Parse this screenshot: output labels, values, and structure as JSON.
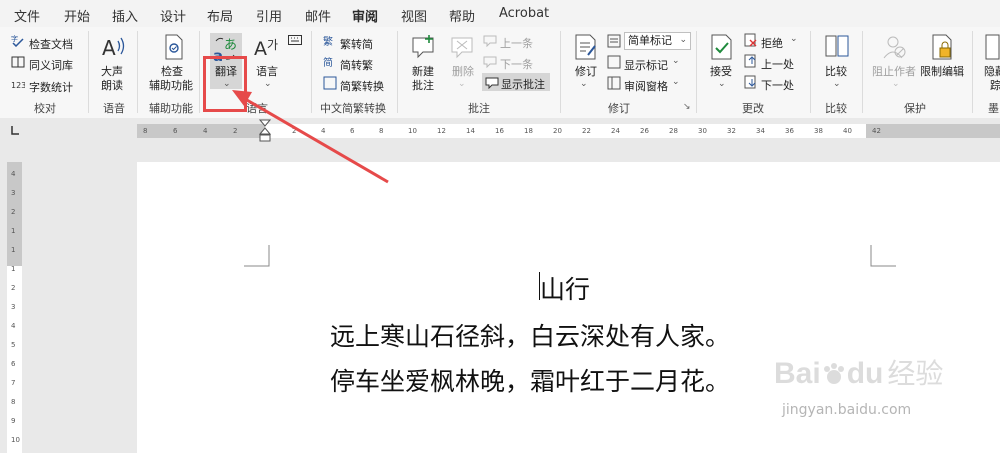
{
  "tabs": [
    "文件",
    "开始",
    "插入",
    "设计",
    "布局",
    "引用",
    "邮件",
    "审阅",
    "视图",
    "帮助",
    "Acrobat"
  ],
  "active_tab": "审阅",
  "ribbon": {
    "proofing": {
      "spelling": "检查文档",
      "thesaurus": "同义词库",
      "wordcount": "字数统计",
      "label": "校对"
    },
    "speech": {
      "read_aloud_1": "大声",
      "read_aloud_2": "朗读",
      "label": "语音"
    },
    "accessibility": {
      "check_1": "检查",
      "check_2": "辅助功能",
      "label": "辅助功能"
    },
    "language": {
      "translate": "翻译",
      "language": "语言",
      "label": "语言"
    },
    "chinese": {
      "to_simplified": "繁转简",
      "to_traditional": "简转繁",
      "convert": "简繁转换",
      "label": "中文简繁转换"
    },
    "comments": {
      "new_1": "新建",
      "new_2": "批注",
      "delete": "删除",
      "prev": "上一条",
      "next": "下一条",
      "show": "显示批注",
      "label": "批注"
    },
    "tracking": {
      "track": "修订",
      "markup": "简单标记",
      "show_markup": "显示标记",
      "review_pane": "审阅窗格",
      "label": "修订"
    },
    "changes": {
      "accept": "接受",
      "reject": "拒绝",
      "prev": "上一处",
      "next": "下一处",
      "label": "更改"
    },
    "compare": {
      "compare": "比较",
      "label": "比较"
    },
    "protect": {
      "block_authors": "阻止作者",
      "restrict": "限制编辑",
      "label": "保护"
    },
    "hide_1": "隐藏",
    "hide_2": "踪",
    "cut_label": "墨"
  },
  "ruler": {
    "ticks_left": [
      "8",
      "6",
      "4",
      "2"
    ],
    "ticks_right": [
      "2",
      "4",
      "6",
      "8",
      "10",
      "12",
      "14",
      "16",
      "18",
      "20",
      "22",
      "24",
      "26",
      "28",
      "30",
      "32",
      "34",
      "36",
      "38",
      "40",
      "42"
    ]
  },
  "vruler_ticks": [
    "4",
    "3",
    "2",
    "1",
    "1",
    "1",
    "2",
    "3",
    "4",
    "5",
    "6",
    "7",
    "8",
    "9",
    "10"
  ],
  "document": {
    "title": "山行",
    "line1": "远上寒山石径斜，白云深处有人家。",
    "line2": "停车坐爱枫林晚，霜叶红于二月花。"
  },
  "watermark": {
    "brand": "Bai",
    "brand2": "du",
    "cn": "经验",
    "url": "jingyan.baidu.com"
  },
  "colors": {
    "accent": "#2b579a",
    "highlight": "#e64a4a",
    "ribbon": "#f7f7f7"
  }
}
